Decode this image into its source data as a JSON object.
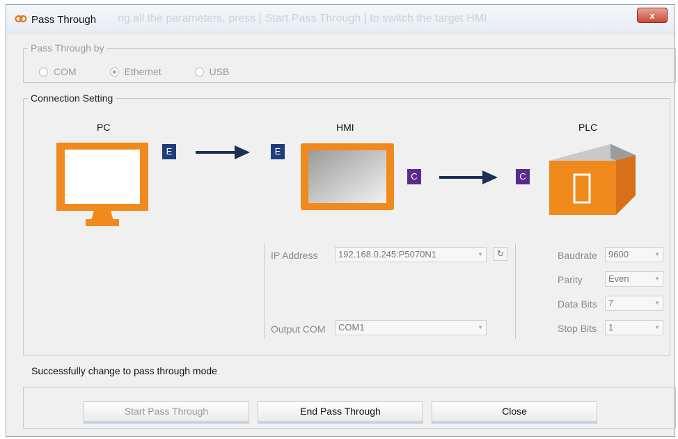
{
  "window": {
    "title": "Pass Through",
    "ghost_text": "ng all the parameters, press [ Start Pass Through ] to switch the target HMI",
    "close_label": "x"
  },
  "pass_through": {
    "legend": "Pass Through by",
    "options": [
      {
        "label": "COM",
        "selected": false
      },
      {
        "label": "Ethernet",
        "selected": true
      },
      {
        "label": "USB",
        "selected": false
      }
    ]
  },
  "connection": {
    "legend": "Connection Setting",
    "devices": {
      "pc": "PC",
      "hmi": "HMI",
      "plc": "PLC"
    },
    "badges": {
      "e": "E",
      "c": "C"
    },
    "ip_label": "IP Address",
    "ip_value": "192.168.0.245:P5070N1",
    "output_com_label": "Output COM",
    "output_com_value": "COM1",
    "baudrate_label": "Baudrate",
    "baudrate_value": "9600",
    "parity_label": "Parity",
    "parity_value": "Even",
    "data_bits_label": "Data Bits",
    "data_bits_value": "7",
    "stop_bits_label": "Stop Bits",
    "stop_bits_value": "1"
  },
  "status_message": "Successfully change to pass through mode",
  "buttons": {
    "start": "Start Pass Through",
    "end": "End Pass Through",
    "close": "Close"
  },
  "colors": {
    "orange": "#f08a1c",
    "arrow": "#1d2f55",
    "badge_e": "#1f3d7a",
    "badge_c": "#5a2b8c"
  }
}
